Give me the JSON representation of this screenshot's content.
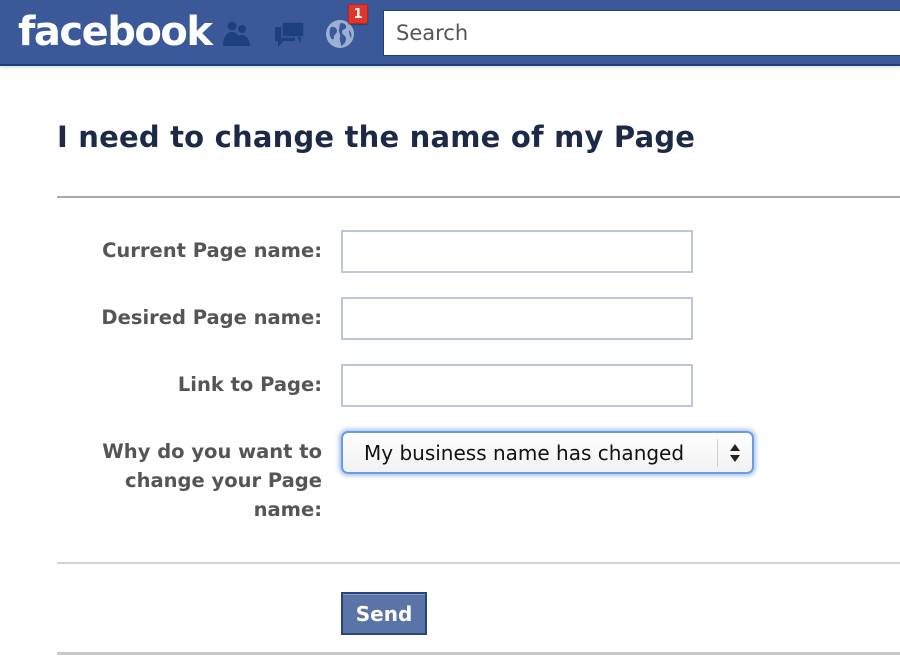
{
  "header": {
    "logo_text": "facebook",
    "jewels": [
      {
        "name": "friend-requests",
        "icon": "friends-icon"
      },
      {
        "name": "messages",
        "icon": "messages-icon"
      },
      {
        "name": "notifications",
        "icon": "globe-icon"
      }
    ],
    "notification_count": "1",
    "search_placeholder": "Search",
    "colors": {
      "bar": "#3b5998",
      "badge": "#e0372b"
    }
  },
  "page": {
    "title": "I need to change the name of my Page"
  },
  "form": {
    "fields": [
      {
        "label": "Current Page name:",
        "value": ""
      },
      {
        "label": "Desired Page name:",
        "value": ""
      },
      {
        "label": "Link to Page:",
        "value": ""
      }
    ],
    "reason": {
      "label_lines": [
        "Why do you want to",
        "change your Page",
        "name:"
      ],
      "selected_option": "My business name has changed"
    },
    "submit_label": "Send"
  }
}
